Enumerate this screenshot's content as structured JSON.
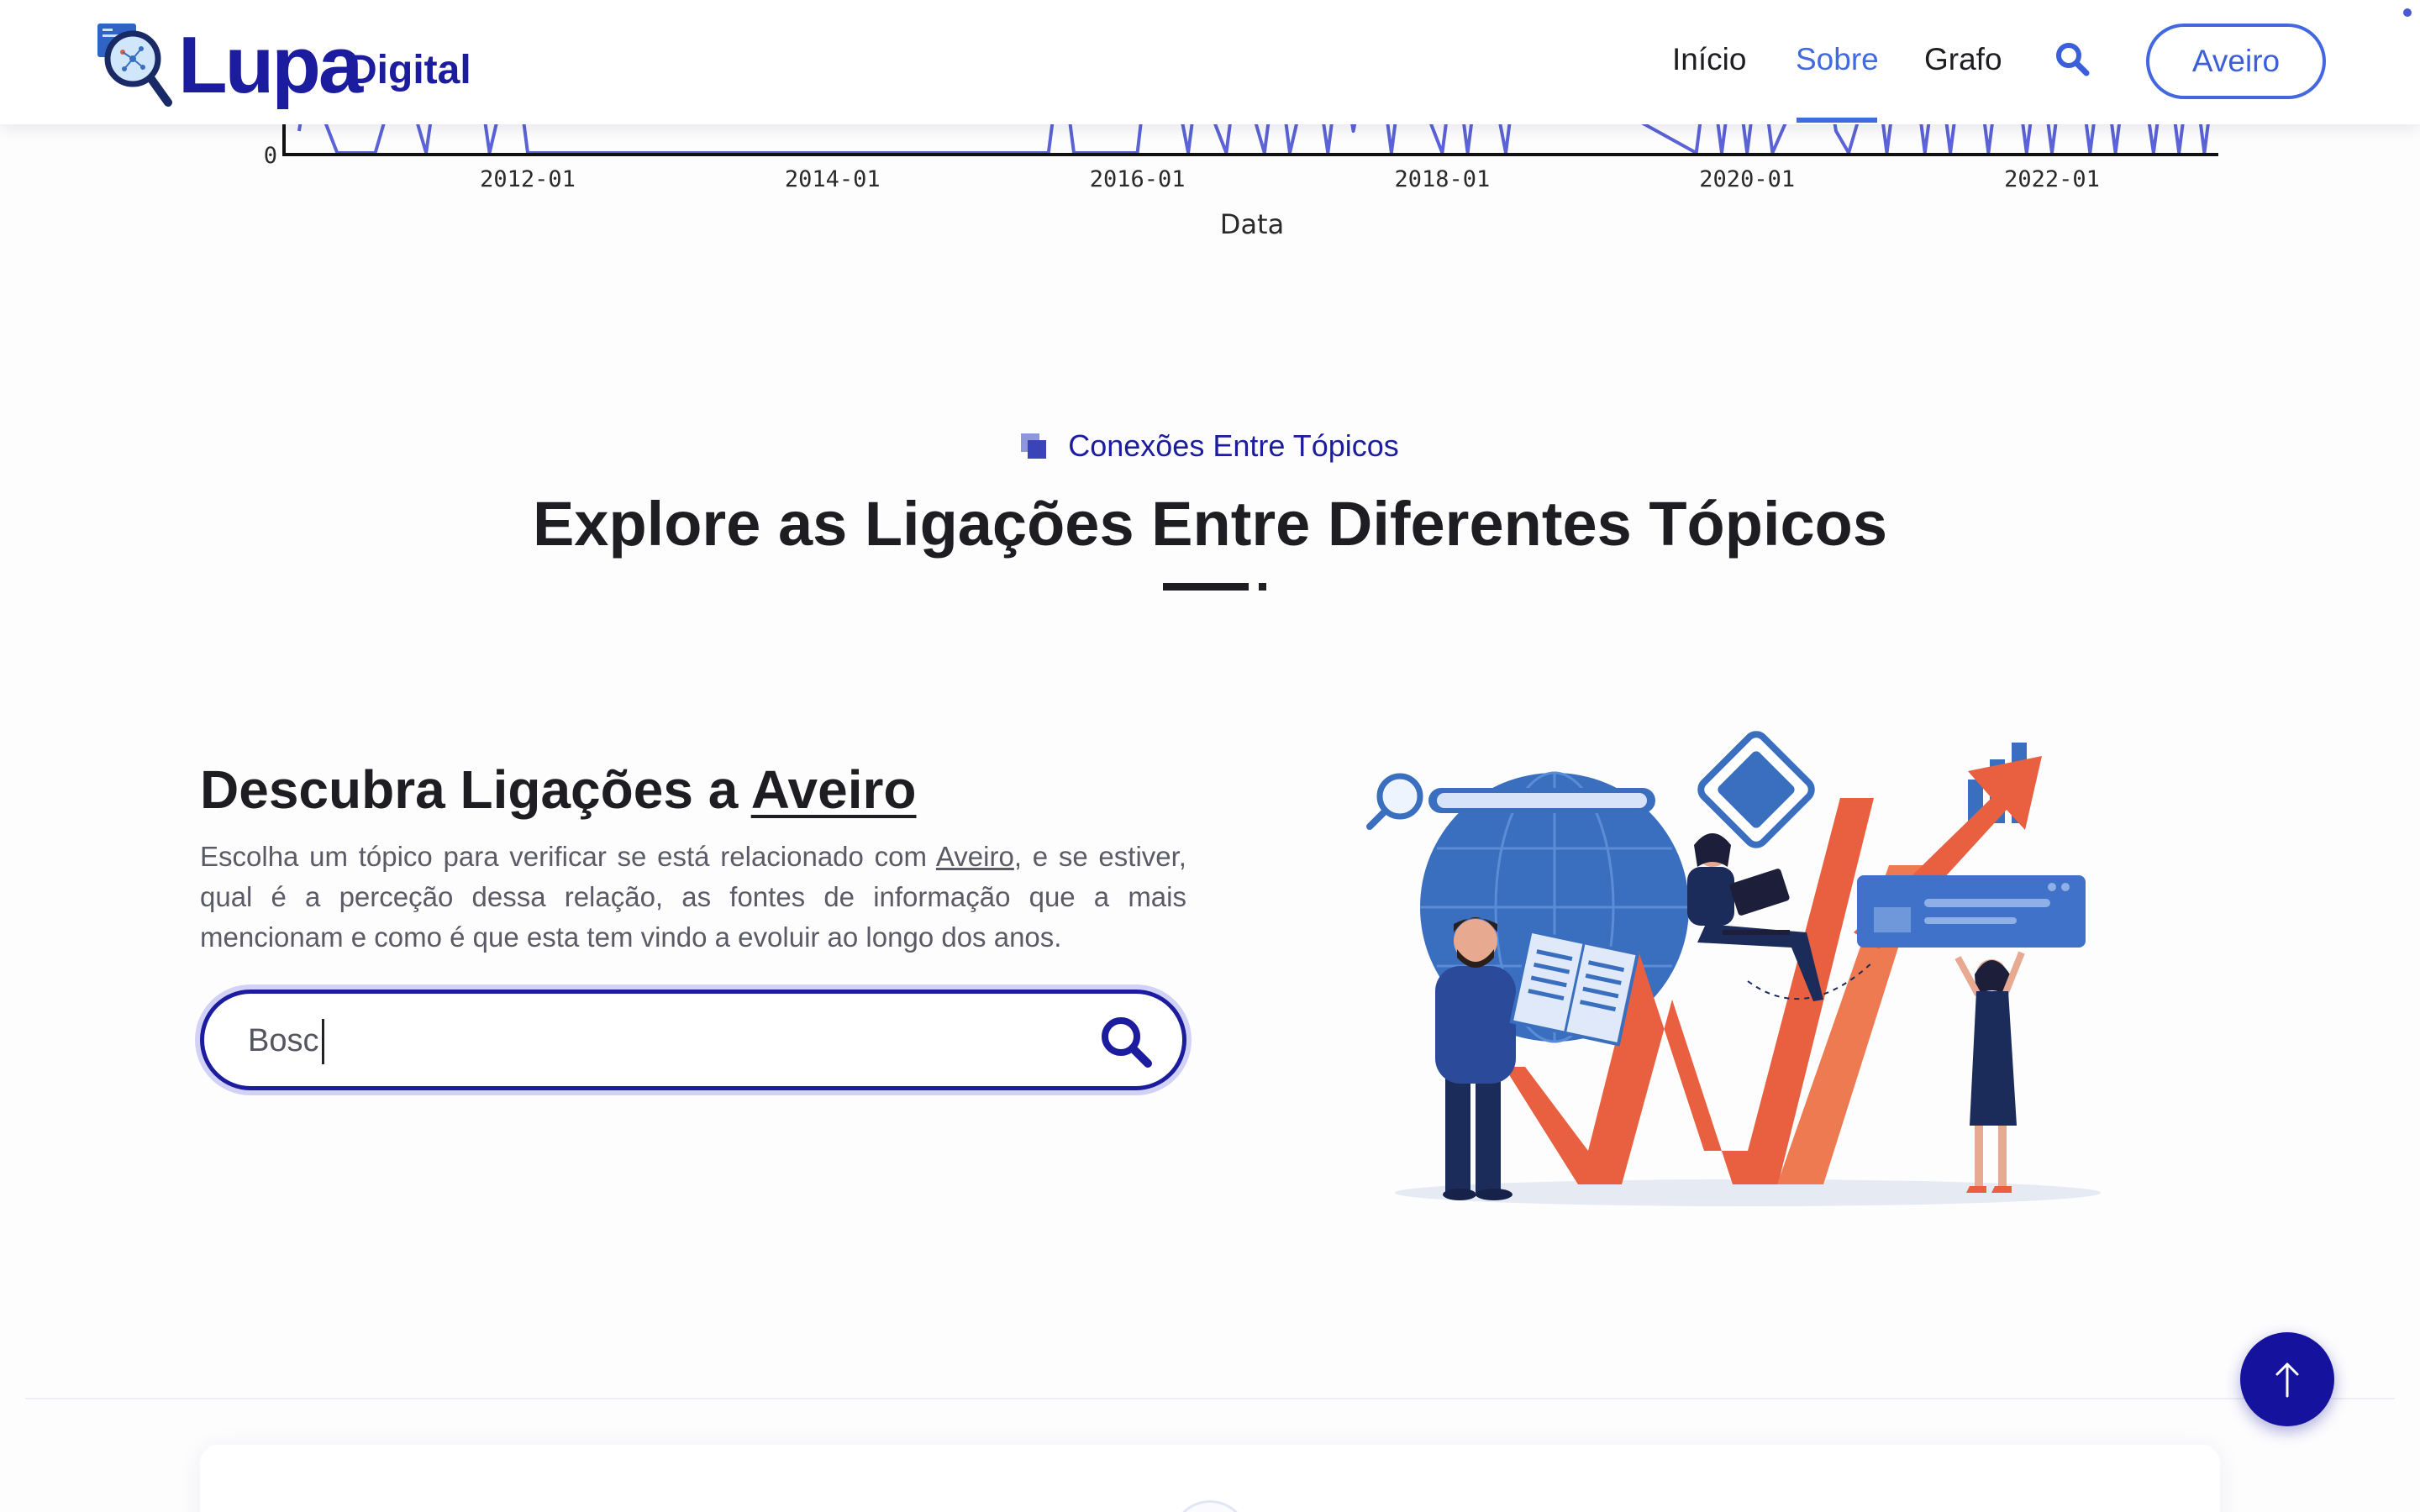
{
  "header": {
    "logo": {
      "main": "Lupa",
      "sub": "Digital"
    },
    "nav": [
      {
        "label": "Início",
        "active": false
      },
      {
        "label": "Sobre",
        "active": true
      },
      {
        "label": "Grafo",
        "active": false
      }
    ],
    "search_icon": "search-icon",
    "city_button": "Aveiro"
  },
  "chart_data": {
    "type": "line",
    "xlabel": "Data",
    "ylabel": "",
    "x_tick_labels": [
      "2012-01",
      "2014-01",
      "2016-01",
      "2018-01",
      "2020-01",
      "2022-01"
    ],
    "y_tick_labels": [
      "0"
    ],
    "xlim": [
      "2010-06",
      "2023-09"
    ],
    "series": [
      {
        "color": "#5b63d6",
        "x": [
          "2010-07",
          "2010-08",
          "2010-09",
          "2010-10",
          "2011-01",
          "2011-03",
          "2011-05",
          "2011-06",
          "2011-08",
          "2011-09",
          "2011-10",
          "2011-11",
          "2011-12",
          "2012-01",
          "2014-02",
          "2015-06",
          "2015-07",
          "2015-08",
          "2016-01",
          "2016-02",
          "2016-03",
          "2016-04",
          "2016-05",
          "2016-06",
          "2016-07",
          "2016-08",
          "2016-09",
          "2016-10",
          "2016-11",
          "2016-12",
          "2017-01",
          "2017-02",
          "2017-03",
          "2017-04",
          "2017-05",
          "2017-06",
          "2017-07",
          "2017-08",
          "2017-09",
          "2017-10",
          "2018-01",
          "2018-02",
          "2018-03",
          "2018-04",
          "2018-05",
          "2018-06",
          "2018-07",
          "2019-09",
          "2019-10",
          "2019-11",
          "2019-12",
          "2020-01",
          "2020-02",
          "2020-03",
          "2020-06",
          "2020-07",
          "2020-08",
          "2020-09",
          "2020-10",
          "2020-11",
          "2020-12",
          "2021-01",
          "2021-02",
          "2021-03",
          "2021-04",
          "2021-05",
          "2021-06",
          "2021-07",
          "2021-08",
          "2021-09",
          "2021-10",
          "2021-11",
          "2021-12",
          "2022-01",
          "2022-02",
          "2022-03",
          "2022-04",
          "2022-05",
          "2022-06",
          "2022-07",
          "2022-08",
          "2022-09",
          "2022-10",
          "2022-11",
          "2022-12",
          "2023-01",
          "2023-02",
          "2023-03"
        ],
        "y": [
          0.2,
          0.9,
          0.3,
          0,
          0,
          0.8,
          0,
          0.8,
          0.3,
          0.8,
          0,
          0.5,
          0.9,
          0,
          0,
          0,
          0.9,
          0,
          0,
          1,
          1,
          0.6,
          0,
          0.9,
          0.3,
          0,
          0.9,
          0.4,
          0,
          0.9,
          0,
          0.5,
          0.8,
          0,
          0.9,
          0.2,
          0.8,
          0.9,
          0,
          0.9,
          0,
          0.9,
          0,
          0.9,
          0.6,
          0,
          0.9,
          0,
          0.9,
          0,
          0.9,
          0,
          0.9,
          0,
          0.8,
          0.9,
          0.2,
          0,
          0.4,
          0.9,
          0,
          0.9,
          0.9,
          0,
          0.9,
          0,
          0.9,
          0.9,
          0,
          0.9,
          0.9,
          0,
          0.9,
          0,
          0.9,
          0.9,
          0,
          0.9,
          0,
          0.9,
          0.8,
          0,
          0.9,
          0,
          0.9,
          0,
          0.9,
          0.9
        ]
      }
    ]
  },
  "connections": {
    "eyebrow": "Conexões Entre Tópicos",
    "title": "Explore as Ligações Entre Diferentes Tópicos"
  },
  "discover": {
    "title_prefix": "Descubra Ligações a ",
    "title_place": "Aveiro",
    "text_prefix": "Escolha um tópico para verificar se está relacionado com ",
    "text_place": "Aveiro",
    "text_suffix": ", e se estiver, qual é a perceção dessa relação, as fontes de informação que a mais mencionam e como é que esta tem vindo a evoluir ao longo dos anos.",
    "search_value": "Bosc",
    "search_icon": "search-icon",
    "illustration": "analytics-team-illustration"
  },
  "back_to_top_icon": "arrow-up-icon",
  "colors": {
    "brand": "#1c1c9e",
    "accent": "#4169e1",
    "chart_line": "#5b63d6",
    "illustration_orange": "#e8603f",
    "illustration_blue": "#3a6fc0"
  }
}
